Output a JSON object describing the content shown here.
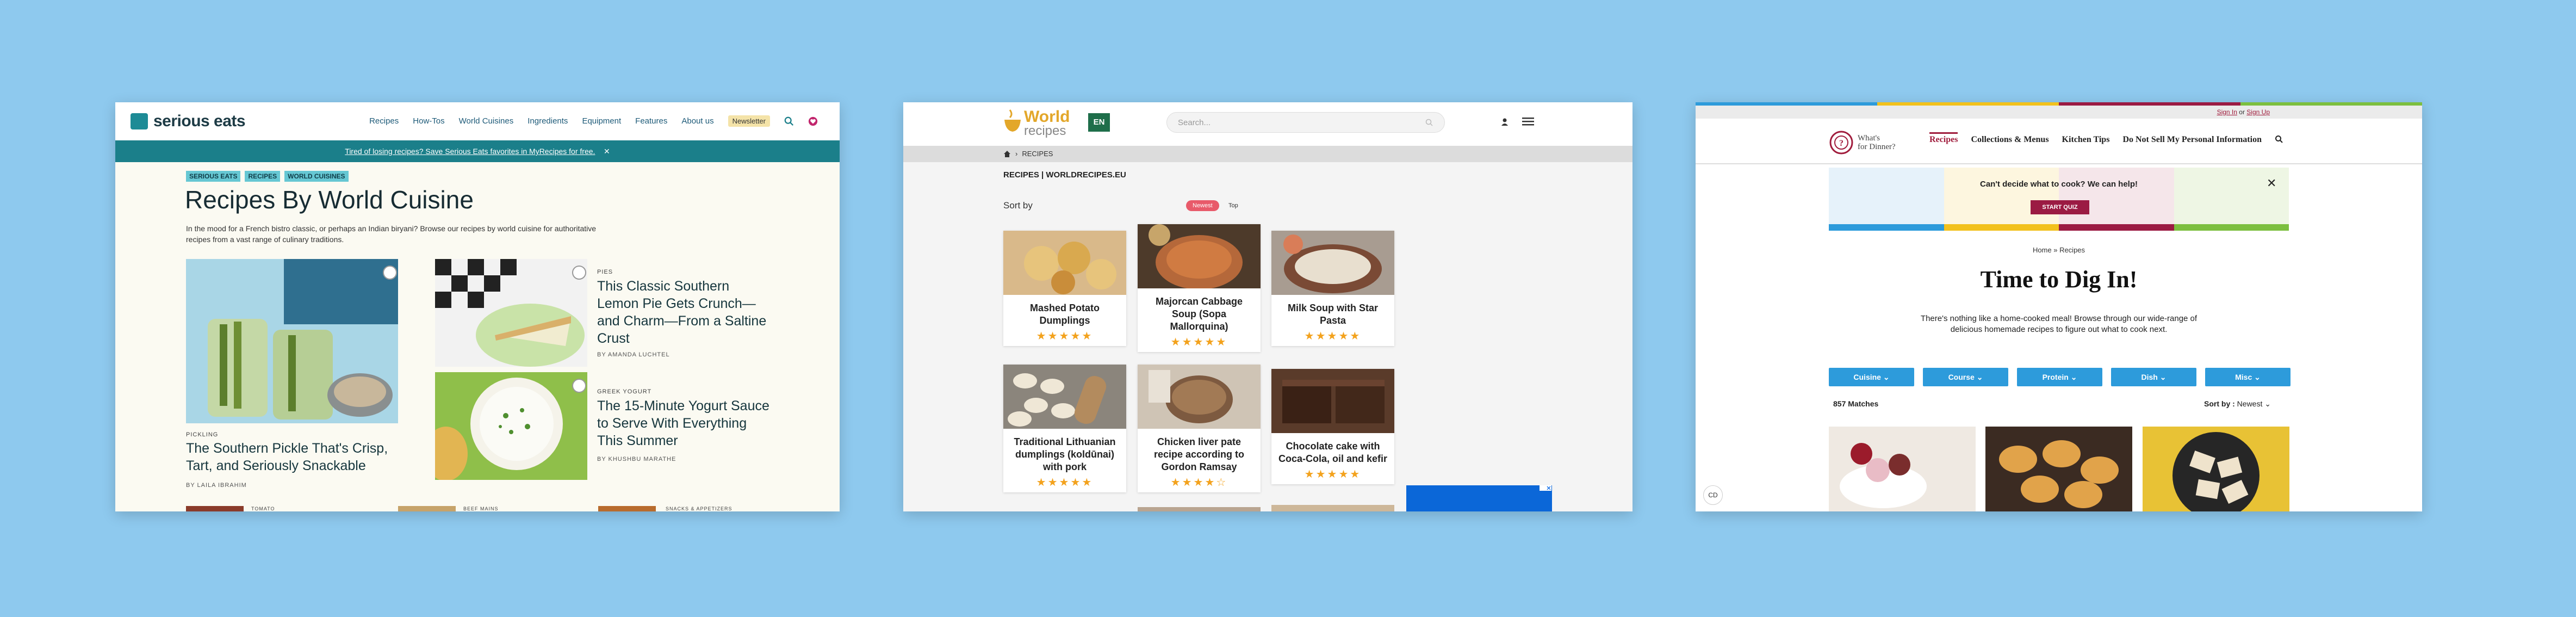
{
  "serious_eats": {
    "logo": "serious eats",
    "nav": [
      "Recipes",
      "How-Tos",
      "World Cuisines",
      "Ingredients",
      "Equipment",
      "Features",
      "About us"
    ],
    "newsletter": "Newsletter",
    "banner": {
      "text": "Tired of losing recipes? Save Serious Eats favorites in MyRecipes for free.",
      "close": "✕"
    },
    "tags": [
      "SERIOUS EATS",
      "RECIPES",
      "WORLD CUISINES"
    ],
    "title": "Recipes By World Cuisine",
    "intro": "In the mood for a French bistro classic, or perhaps an Indian biryani? Browse our recipes by world cuisine for authoritative recipes from a vast range of culinary traditions.",
    "articles": [
      {
        "kicker": "PICKLING",
        "title": "The Southern Pickle That's Crisp, Tart, and Seriously Snackable",
        "byline": "BY LAILA IBRAHIM"
      },
      {
        "kicker": "PIES",
        "title": "This Classic Southern Lemon Pie Gets Crunch—and Charm—From a Saltine Crust",
        "byline": "BY AMANDA LUCHTEL"
      },
      {
        "kicker": "GREEK YOGURT",
        "title": "The 15-Minute Yogurt Sauce to Serve With Everything This Summer",
        "byline": "BY KHUSHBU MARATHE"
      }
    ],
    "bottom_kickers": [
      "TOMATO",
      "BEEF MAINS",
      "SNACKS & APPETIZERS"
    ]
  },
  "world_recipes": {
    "logo_main": "World",
    "logo_sub": "recipes",
    "lang": "EN",
    "search_placeholder": "Search...",
    "breadcrumb": "RECIPES",
    "section": "RECIPES | WORLDRECIPES.EU",
    "sort_by": "Sort by",
    "sort_options": [
      "Newest",
      "Top"
    ],
    "cards": [
      {
        "title": "Mashed Potato Dumplings",
        "stars": "★★★★★"
      },
      {
        "title": "Majorcan Cabbage Soup (Sopa Mallorquina)",
        "stars": "★★★★★"
      },
      {
        "title": "Milk Soup with Star Pasta",
        "stars": "★★★★★"
      },
      {
        "title": "Traditional Lithuanian dumplings (koldūnai) with pork",
        "stars": "★★★★★"
      },
      {
        "title": "Chicken liver pate recipe according to Gordon Ramsay",
        "stars": "★★★★☆"
      },
      {
        "title": "Chocolate cake with Coca-Cola, oil and kefir",
        "stars": "★★★★★"
      }
    ]
  },
  "whats_for_dinner": {
    "sign_in": "Sign In",
    "or": "or",
    "sign_up": "Sign Up",
    "logo_line1": "What's",
    "logo_line2": "for Dinner?",
    "nav": [
      "Recipes",
      "Collections & Menus",
      "Kitchen Tips",
      "Do Not Sell My Personal Information"
    ],
    "quiz_text": "Can't decide what to cook? We can help!",
    "quiz_button": "START QUIZ",
    "breadcrumb": "Home »  Recipes",
    "title": "Time to Dig In!",
    "intro": "There's nothing like a home-cooked meal! Browse through our wide-range of delicious homemade recipes to figure out what to cook next.",
    "filters": [
      "Cuisine",
      "Course",
      "Protein",
      "Dish",
      "Misc"
    ],
    "matches": "857 Matches",
    "sort_label": "Sort by :",
    "sort_value": "Newest",
    "accessibility": "CD"
  },
  "colors": {
    "background": "#8ec9ee",
    "se_teal": "#1b7f8a",
    "wr_green": "#1e6e4a",
    "wr_star": "#f3a21d",
    "wd_red": "#a01c3c",
    "wd_blue": "#2d9bdb"
  }
}
